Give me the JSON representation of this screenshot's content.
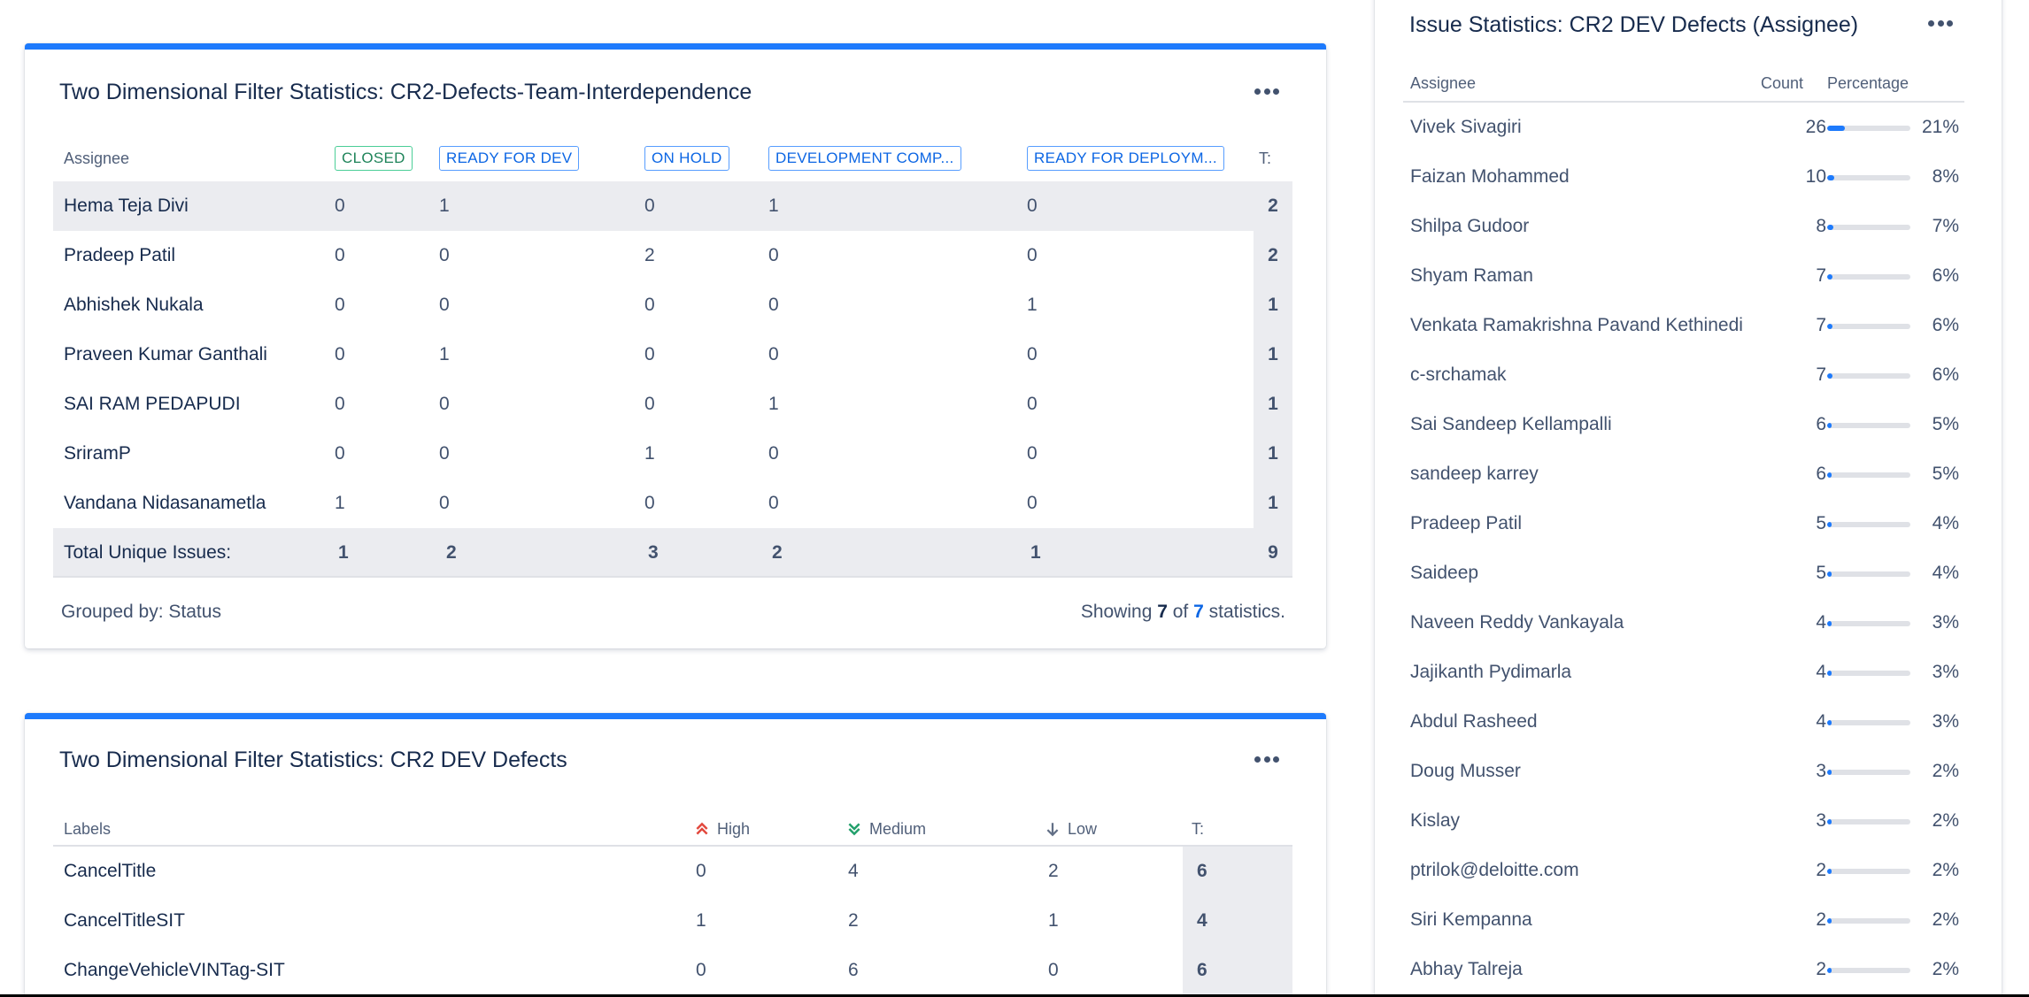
{
  "gadget1": {
    "title": "Two Dimensional Filter Statistics: CR2-Defects-Team-Interdependence",
    "row_header": "Assignee",
    "columns": [
      "CLOSED",
      "READY FOR DEV",
      "ON HOLD",
      "DEVELOPMENT COMP...",
      "READY FOR DEPLOYM..."
    ],
    "total_header": "T:",
    "rows": [
      {
        "name": "Hema Teja Divi",
        "vals": [
          "0",
          "1",
          "0",
          "1",
          "0"
        ],
        "total": "2"
      },
      {
        "name": "Pradeep Patil",
        "vals": [
          "0",
          "0",
          "2",
          "0",
          "0"
        ],
        "total": "2"
      },
      {
        "name": "Abhishek Nukala",
        "vals": [
          "0",
          "0",
          "0",
          "0",
          "1"
        ],
        "total": "1"
      },
      {
        "name": "Praveen Kumar Ganthali",
        "vals": [
          "0",
          "1",
          "0",
          "0",
          "0"
        ],
        "total": "1"
      },
      {
        "name": "SAI RAM PEDAPUDI",
        "vals": [
          "0",
          "0",
          "0",
          "1",
          "0"
        ],
        "total": "1"
      },
      {
        "name": "SriramP",
        "vals": [
          "0",
          "0",
          "1",
          "0",
          "0"
        ],
        "total": "1"
      },
      {
        "name": "Vandana Nidasanametla",
        "vals": [
          "1",
          "0",
          "0",
          "0",
          "0"
        ],
        "total": "1"
      }
    ],
    "totals": {
      "label": "Total Unique Issues:",
      "vals": [
        "1",
        "2",
        "3",
        "2",
        "1"
      ],
      "total": "9"
    },
    "grouped_by": "Grouped by: Status",
    "showing": {
      "prefix": "Showing",
      "shown": "7",
      "of": "of",
      "total": "7",
      "suffix": "statistics."
    }
  },
  "gadget2": {
    "title": "Two Dimensional Filter Statistics: CR2 DEV Defects",
    "row_header": "Labels",
    "columns": [
      {
        "label": "High",
        "icon": "priority-high-icon",
        "color": "#e2483d"
      },
      {
        "label": "Medium",
        "icon": "priority-medium-icon",
        "color": "#22a06b"
      },
      {
        "label": "Low",
        "icon": "priority-low-icon",
        "color": "#626f86"
      }
    ],
    "total_header": "T:",
    "rows": [
      {
        "name": "CancelTitle",
        "vals": [
          "0",
          "4",
          "2"
        ],
        "total": "6"
      },
      {
        "name": "CancelTitleSIT",
        "vals": [
          "1",
          "2",
          "1"
        ],
        "total": "4"
      },
      {
        "name": "ChangeVehicleVINTag-SIT",
        "vals": [
          "0",
          "6",
          "0"
        ],
        "total": "6"
      }
    ]
  },
  "gadget3": {
    "title": "Issue Statistics: CR2 DEV Defects (Assignee)",
    "headers": {
      "assignee": "Assignee",
      "count": "Count",
      "percentage": "Percentage"
    },
    "rows": [
      {
        "name": "Vivek Sivagiri",
        "count": "26",
        "pct": "21%",
        "fraction": 0.21
      },
      {
        "name": "Faizan Mohammed",
        "count": "10",
        "pct": "8%",
        "fraction": 0.08
      },
      {
        "name": "Shilpa Gudoor",
        "count": "8",
        "pct": "7%",
        "fraction": 0.07
      },
      {
        "name": "Shyam Raman",
        "count": "7",
        "pct": "6%",
        "fraction": 0.06
      },
      {
        "name": "Venkata Ramakrishna Pavand Kethinedi",
        "count": "7",
        "pct": "6%",
        "fraction": 0.06
      },
      {
        "name": "c-srchamak",
        "count": "7",
        "pct": "6%",
        "fraction": 0.06
      },
      {
        "name": "Sai Sandeep Kellampalli",
        "count": "6",
        "pct": "5%",
        "fraction": 0.05
      },
      {
        "name": "sandeep karrey",
        "count": "6",
        "pct": "5%",
        "fraction": 0.05
      },
      {
        "name": "Pradeep Patil",
        "count": "5",
        "pct": "4%",
        "fraction": 0.04
      },
      {
        "name": "Saideep",
        "count": "5",
        "pct": "4%",
        "fraction": 0.04
      },
      {
        "name": "Naveen Reddy Vankayala",
        "count": "4",
        "pct": "3%",
        "fraction": 0.03
      },
      {
        "name": "Jajikanth Pydimarla",
        "count": "4",
        "pct": "3%",
        "fraction": 0.03
      },
      {
        "name": "Abdul Rasheed",
        "count": "4",
        "pct": "3%",
        "fraction": 0.03
      },
      {
        "name": "Doug Musser",
        "count": "3",
        "pct": "2%",
        "fraction": 0.02
      },
      {
        "name": "Kislay",
        "count": "3",
        "pct": "2%",
        "fraction": 0.02
      },
      {
        "name": "ptrilok@deloitte.com",
        "count": "2",
        "pct": "2%",
        "fraction": 0.02
      },
      {
        "name": "Siri Kempanna",
        "count": "2",
        "pct": "2%",
        "fraction": 0.02
      },
      {
        "name": "Abhay Talreja",
        "count": "2",
        "pct": "2%",
        "fraction": 0.02
      }
    ]
  }
}
